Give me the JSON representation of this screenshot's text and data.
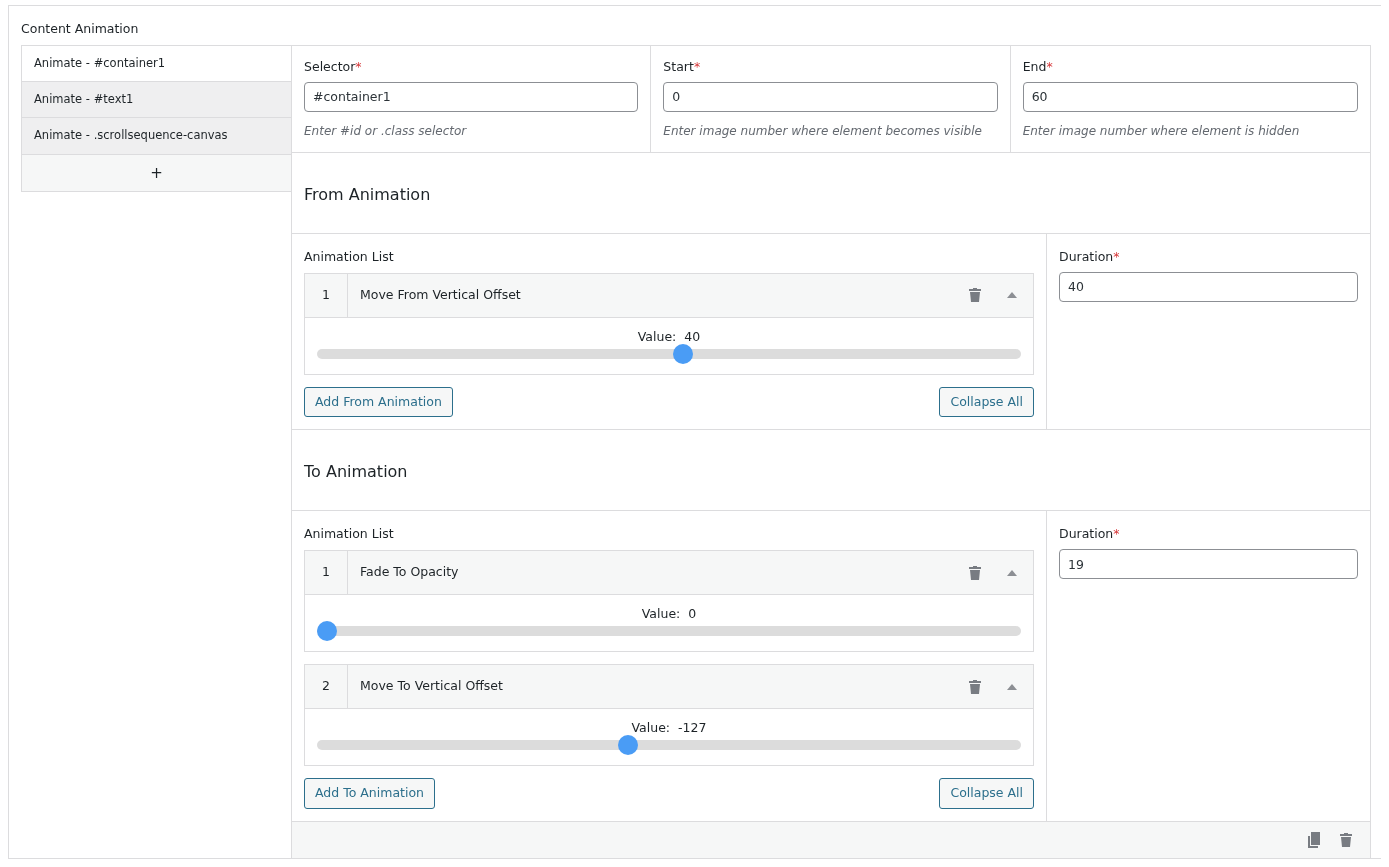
{
  "section_title": "Content Animation",
  "sidebar": {
    "items": [
      {
        "label": "Animate - #container1",
        "selected": true
      },
      {
        "label": "Animate - #text1",
        "selected": false
      },
      {
        "label": "Animate - .scrollsequence-canvas",
        "selected": false
      }
    ],
    "add_label": "+"
  },
  "fields": [
    {
      "label": "Selector",
      "required_mark": "*",
      "value": "#container1",
      "help": "Enter #id or .class selector"
    },
    {
      "label": "Start",
      "required_mark": "*",
      "value": "0",
      "help": "Enter image number where element becomes visible"
    },
    {
      "label": "End",
      "required_mark": "*",
      "value": "60",
      "help": "Enter image number where element is hidden"
    }
  ],
  "groups": [
    {
      "title": "From Animation",
      "list_label": "Animation List",
      "items": [
        {
          "number": "1",
          "name": "Move From Vertical Offset",
          "expanded": true,
          "value_label": "Value:",
          "value": "40",
          "level": 0.52
        }
      ],
      "add_button": "Add From Animation",
      "collapse_button": "Collapse All",
      "duration": {
        "label": "Duration",
        "required_mark": "*",
        "value": "40"
      }
    },
    {
      "title": "To Animation",
      "list_label": "Animation List",
      "items": [
        {
          "number": "1",
          "name": "Fade To Opacity",
          "expanded": true,
          "value_label": "Value:",
          "value": "0",
          "level": 0
        },
        {
          "number": "2",
          "name": "Move To Vertical Offset",
          "expanded": true,
          "value_label": "Value:",
          "value": "-127",
          "level": 0.44
        }
      ],
      "add_button": "Add To Animation",
      "collapse_button": "Collapse All",
      "duration": {
        "label": "Duration",
        "required_mark": "*",
        "value": "19"
      }
    }
  ]
}
